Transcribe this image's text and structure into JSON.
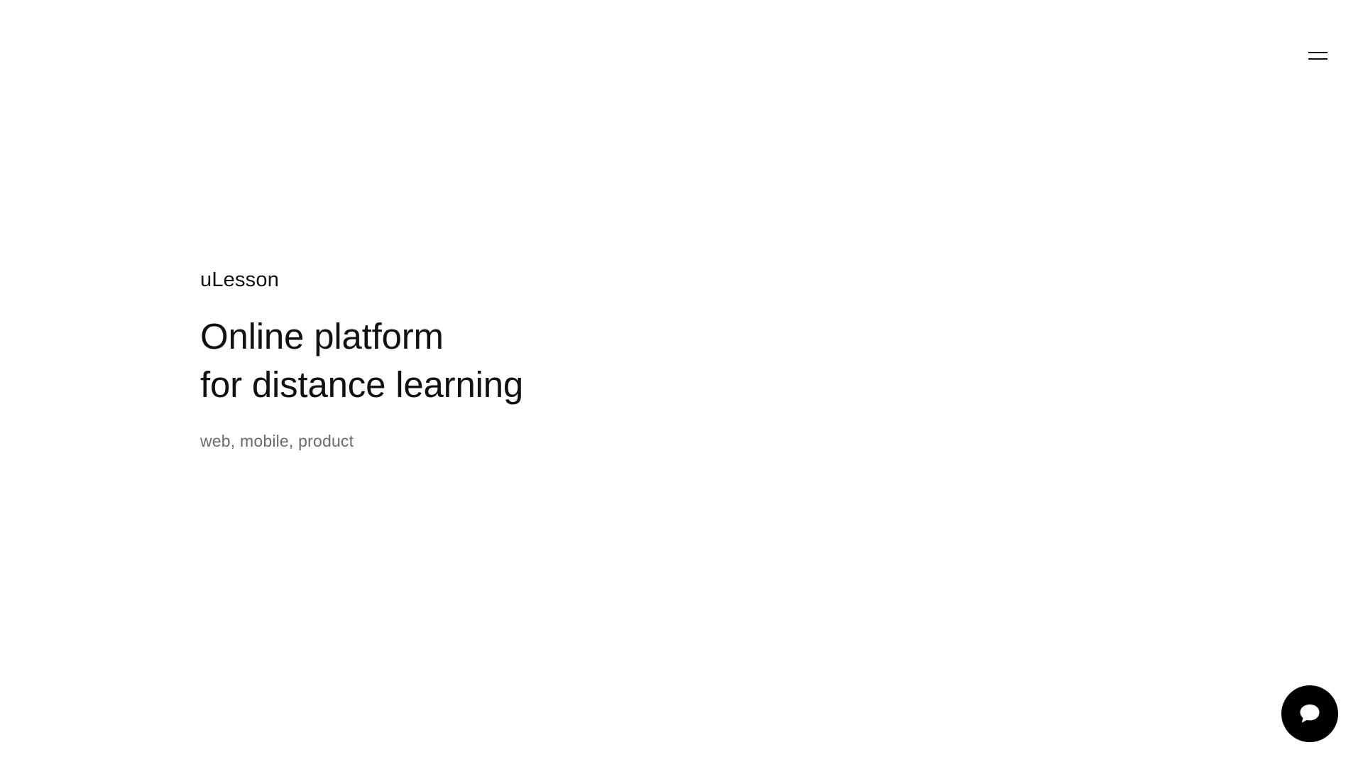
{
  "header": {
    "menu_icon": "hamburger-menu-icon"
  },
  "hero": {
    "eyebrow": "uLesson",
    "headline_line1": "Online platform",
    "headline_line2": "for distance learning",
    "tags": "web, mobile, product"
  },
  "chat": {
    "icon": "chat-bubble-icon"
  },
  "colors": {
    "background": "#ffffff",
    "text_primary": "#111111",
    "text_secondary": "#6b6b6b",
    "chat_button": "#000000",
    "chat_icon": "#ffffff"
  }
}
